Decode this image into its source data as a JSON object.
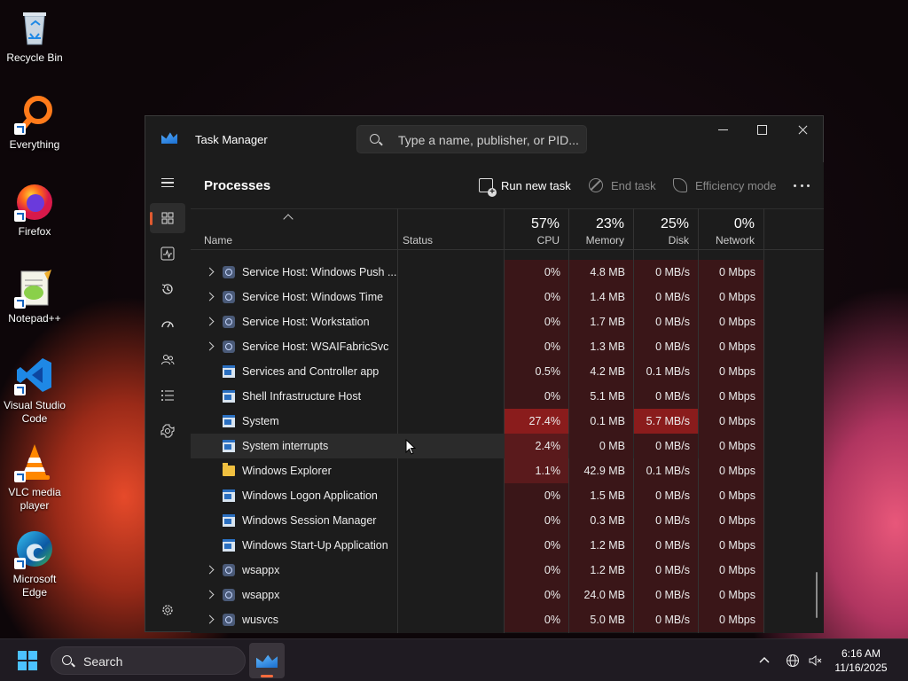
{
  "desktop": {
    "icons": [
      {
        "label": "Recycle Bin"
      },
      {
        "label": "Everything"
      },
      {
        "label": "Firefox"
      },
      {
        "label": "Notepad++"
      },
      {
        "label": "Visual Studio Code"
      },
      {
        "label": "VLC media player"
      },
      {
        "label": "Microsoft Edge"
      }
    ]
  },
  "window": {
    "title": "Task Manager",
    "search_placeholder": "Type a name, publisher, or PID..."
  },
  "nav": {
    "items": [
      {
        "icon": "hamburger-icon"
      },
      {
        "icon": "processes-icon",
        "active": true
      },
      {
        "icon": "performance-icon"
      },
      {
        "icon": "app-history-icon"
      },
      {
        "icon": "startup-apps-icon"
      },
      {
        "icon": "users-icon"
      },
      {
        "icon": "details-icon"
      },
      {
        "icon": "services-icon"
      },
      {
        "icon": "settings-icon"
      }
    ]
  },
  "page": {
    "title": "Processes",
    "run_new_task": "Run new task",
    "end_task": "End task",
    "efficiency_mode": "Efficiency mode"
  },
  "columns": {
    "name": "Name",
    "status": "Status",
    "cpu": {
      "pct": "57%",
      "label": "CPU"
    },
    "memory": {
      "pct": "23%",
      "label": "Memory"
    },
    "disk": {
      "pct": "25%",
      "label": "Disk"
    },
    "network": {
      "pct": "0%",
      "label": "Network"
    }
  },
  "rows": [
    {
      "name": "Service Host: Windows Push ...",
      "expand": true,
      "icon": "gear",
      "cpu": "0%",
      "memory": "4.8 MB",
      "disk": "0 MB/s",
      "network": "0 Mbps"
    },
    {
      "name": "Service Host: Windows Time",
      "expand": true,
      "icon": "gear",
      "cpu": "0%",
      "memory": "1.4 MB",
      "disk": "0 MB/s",
      "network": "0 Mbps"
    },
    {
      "name": "Service Host: Workstation",
      "expand": true,
      "icon": "gear",
      "cpu": "0%",
      "memory": "1.7 MB",
      "disk": "0 MB/s",
      "network": "0 Mbps"
    },
    {
      "name": "Service Host: WSAIFabricSvc",
      "expand": true,
      "icon": "gear",
      "cpu": "0%",
      "memory": "1.3 MB",
      "disk": "0 MB/s",
      "network": "0 Mbps"
    },
    {
      "name": "Services and Controller app",
      "expand": false,
      "icon": "win",
      "cpu": "0.5%",
      "memory": "4.2 MB",
      "disk": "0.1 MB/s",
      "network": "0 Mbps"
    },
    {
      "name": "Shell Infrastructure Host",
      "expand": false,
      "icon": "win",
      "cpu": "0%",
      "memory": "5.1 MB",
      "disk": "0 MB/s",
      "network": "0 Mbps"
    },
    {
      "name": "System",
      "expand": false,
      "icon": "win",
      "cpu": "27.4%",
      "memory": "0.1 MB",
      "disk": "5.7 MB/s",
      "network": "0 Mbps"
    },
    {
      "name": "System interrupts",
      "expand": false,
      "icon": "win",
      "cpu": "2.4%",
      "memory": "0 MB",
      "disk": "0 MB/s",
      "network": "0 Mbps",
      "hover": true
    },
    {
      "name": "Windows Explorer",
      "expand": false,
      "icon": "folder",
      "cpu": "1.1%",
      "memory": "42.9 MB",
      "disk": "0.1 MB/s",
      "network": "0 Mbps"
    },
    {
      "name": "Windows Logon Application",
      "expand": false,
      "icon": "win",
      "cpu": "0%",
      "memory": "1.5 MB",
      "disk": "0 MB/s",
      "network": "0 Mbps"
    },
    {
      "name": "Windows Session Manager",
      "expand": false,
      "icon": "win",
      "cpu": "0%",
      "memory": "0.3 MB",
      "disk": "0 MB/s",
      "network": "0 Mbps"
    },
    {
      "name": "Windows Start-Up Application",
      "expand": false,
      "icon": "win",
      "cpu": "0%",
      "memory": "1.2 MB",
      "disk": "0 MB/s",
      "network": "0 Mbps"
    },
    {
      "name": "wsappx",
      "expand": true,
      "icon": "gear",
      "cpu": "0%",
      "memory": "1.2 MB",
      "disk": "0 MB/s",
      "network": "0 Mbps"
    },
    {
      "name": "wsappx",
      "expand": true,
      "icon": "gear",
      "cpu": "0%",
      "memory": "24.0 MB",
      "disk": "0 MB/s",
      "network": "0 Mbps"
    },
    {
      "name": "wusvcs",
      "expand": true,
      "icon": "gear",
      "cpu": "0%",
      "memory": "5.0 MB",
      "disk": "0 MB/s",
      "network": "0 Mbps"
    }
  ],
  "taskbar": {
    "search_label": "Search",
    "time": "6:16 AM",
    "date": "11/16/2025"
  },
  "colors": {
    "heat_low": "#3a1618",
    "heat_mid": "#5a1a1c",
    "heat_high": "#8a1c1c",
    "accent": "#4cc2ff",
    "nav_indicator": "#e05a30"
  }
}
